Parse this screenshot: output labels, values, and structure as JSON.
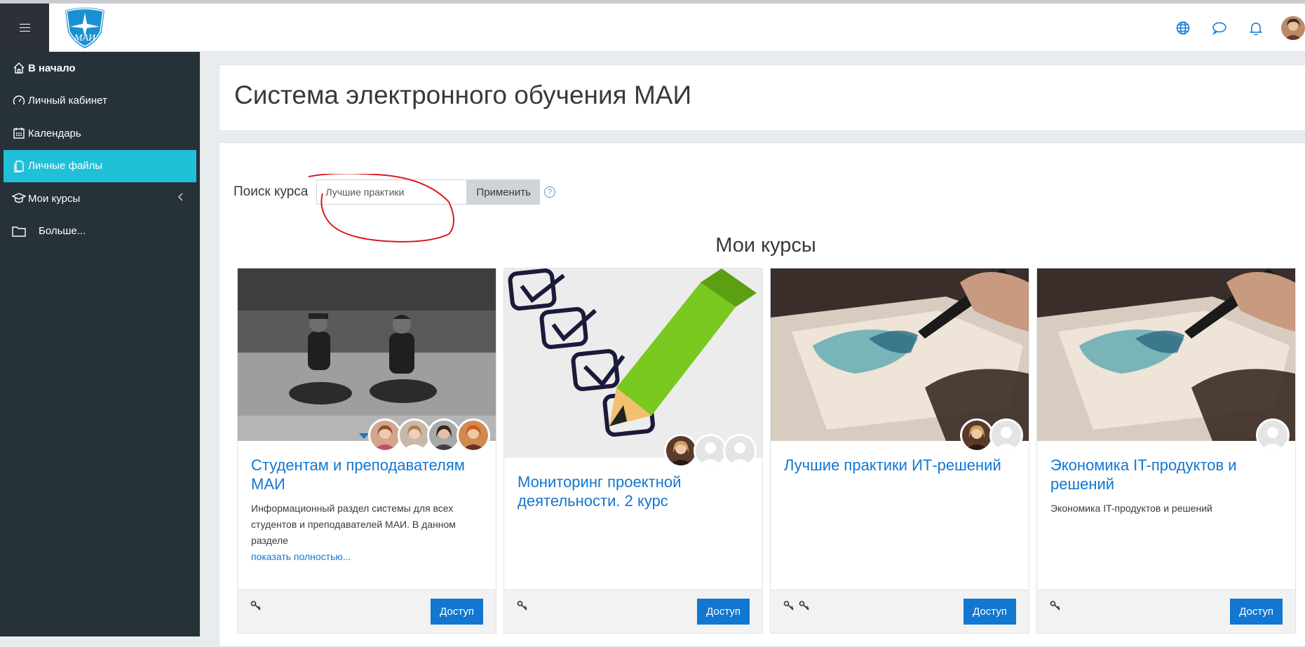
{
  "header": {
    "title": "Система электронного обучения МАИ",
    "logo_text": "МАИ"
  },
  "sidebar": {
    "items": [
      {
        "label": "В начало",
        "icon": "home-icon"
      },
      {
        "label": "Личный кабинет",
        "icon": "dashboard-icon"
      },
      {
        "label": "Календарь",
        "icon": "calendar-icon"
      },
      {
        "label": "Личные файлы",
        "icon": "file-icon"
      },
      {
        "label": "Мои курсы",
        "icon": "graduation-cap-icon"
      },
      {
        "label": "Больше...",
        "icon": "folder-icon"
      }
    ]
  },
  "search": {
    "label": "Поиск курса",
    "value": "Лучшие практики",
    "button": "Применить"
  },
  "section_title": "Мои курсы",
  "courses": [
    {
      "title": "Студентам и преподавателям МАИ",
      "summary": "Информационный раздел системы для всех студентов и преподавателей МАИ. В данном разделе",
      "more": "показать полностью...",
      "button": "Доступ"
    },
    {
      "title": "Мониторинг проектной деятельности. 2 курс",
      "summary": "",
      "button": "Доступ"
    },
    {
      "title": "Лучшие практики ИТ-решений",
      "summary": "",
      "button": "Доступ"
    },
    {
      "title": "Экономика IT-продуктов и решений",
      "summary": "Экономика IT-продуктов и решений",
      "button": "Доступ"
    }
  ],
  "colors": {
    "sidebar": "#263238",
    "active": "#20c0d8",
    "link": "#1177d1",
    "button": "#1177d1"
  }
}
